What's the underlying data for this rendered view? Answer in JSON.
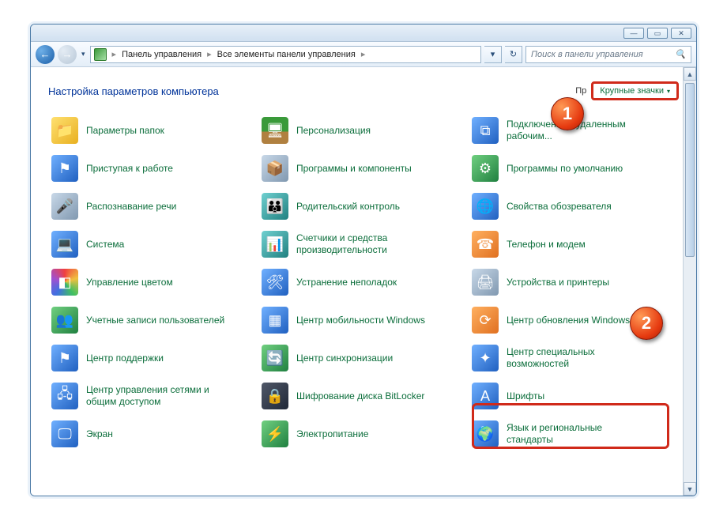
{
  "window": {
    "min": "—",
    "max": "▭",
    "close": "✕"
  },
  "addrbar": {
    "crumb1": "Панель управления",
    "crumb2": "Все элементы панели управления",
    "refresh": "↻",
    "dropdown": "▾"
  },
  "search": {
    "placeholder": "Поиск в панели управления",
    "icon": "🔍"
  },
  "heading": "Настройка параметров компьютера",
  "viewby": {
    "label": "Просмотр:",
    "label_trunc": "Пр",
    "value": "Крупные значки",
    "tri": "▾"
  },
  "items": [
    {
      "label": "Параметры папок",
      "ico": "ic-yellow",
      "g": "📁"
    },
    {
      "label": "Персонализация",
      "ico": "ic-desk",
      "g": "🖥"
    },
    {
      "label": "Подключения к удаленным рабочим...",
      "ico": "ic-blue",
      "g": "⧉"
    },
    {
      "label": "Приступая к работе",
      "ico": "ic-blue",
      "g": "⚑"
    },
    {
      "label": "Программы и компоненты",
      "ico": "ic-grey",
      "g": "📦"
    },
    {
      "label": "Программы по умолчанию",
      "ico": "ic-green",
      "g": "⚙"
    },
    {
      "label": "Распознавание речи",
      "ico": "ic-grey",
      "g": "🎤"
    },
    {
      "label": "Родительский контроль",
      "ico": "ic-teal",
      "g": "👪"
    },
    {
      "label": "Свойства обозревателя",
      "ico": "ic-blue",
      "g": "🌐"
    },
    {
      "label": "Система",
      "ico": "ic-blue",
      "g": "💻"
    },
    {
      "label": "Счетчики и средства производительности",
      "ico": "ic-teal",
      "g": "📊"
    },
    {
      "label": "Телефон и модем",
      "ico": "ic-orange",
      "g": "☎"
    },
    {
      "label": "Управление цветом",
      "ico": "ic-multi",
      "g": "◧"
    },
    {
      "label": "Устранение неполадок",
      "ico": "ic-blue",
      "g": "🛠"
    },
    {
      "label": "Устройства и принтеры",
      "ico": "ic-grey",
      "g": "🖨"
    },
    {
      "label": "Учетные записи пользователей",
      "ico": "ic-green",
      "g": "👥"
    },
    {
      "label": "Центр мобильности Windows",
      "ico": "ic-blue",
      "g": "▦"
    },
    {
      "label": "Центр обновления Windows",
      "ico": "ic-orange",
      "g": "⟳"
    },
    {
      "label": "Центр поддержки",
      "ico": "ic-blue",
      "g": "⚑"
    },
    {
      "label": "Центр синхронизации",
      "ico": "ic-green",
      "g": "🔄"
    },
    {
      "label": "Центр специальных возможностей",
      "ico": "ic-blue",
      "g": "✦"
    },
    {
      "label": "Центр управления сетями и общим доступом",
      "ico": "ic-blue",
      "g": "🖧"
    },
    {
      "label": "Шифрование диска BitLocker",
      "ico": "ic-dark",
      "g": "🔒"
    },
    {
      "label": "Шрифты",
      "ico": "ic-blue",
      "g": "A"
    },
    {
      "label": "Экран",
      "ico": "ic-blue",
      "g": "🖵"
    },
    {
      "label": "Электропитание",
      "ico": "ic-green",
      "g": "⚡"
    },
    {
      "label": "Язык и региональные стандарты",
      "ico": "ic-blue",
      "g": "🌍"
    }
  ],
  "callouts": {
    "c1": "1",
    "c2": "2"
  }
}
